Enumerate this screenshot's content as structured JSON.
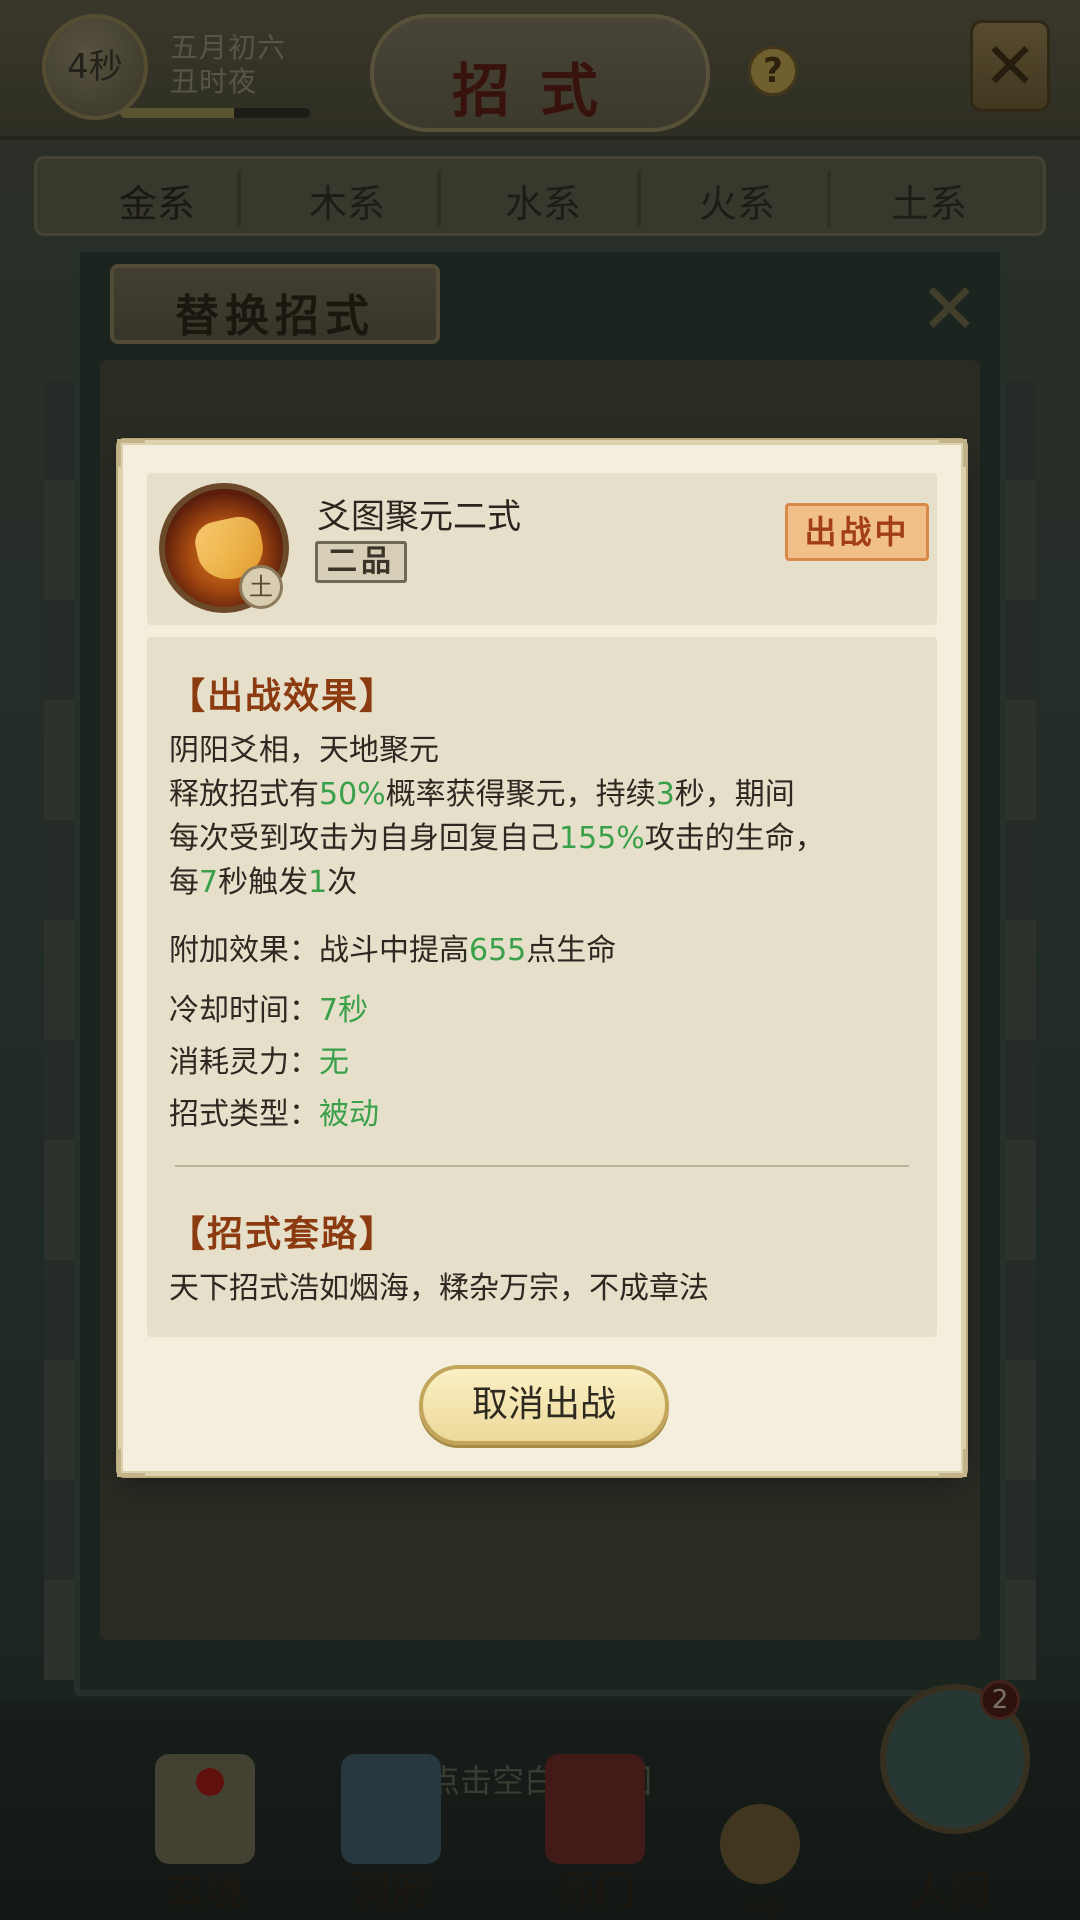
{
  "header": {
    "timer": "4秒",
    "date_line1": "五月初六",
    "date_line2": "丑时夜",
    "title": "招式",
    "help_symbol": "?",
    "time_progress": 0.6
  },
  "element_tabs": [
    "金系",
    "木系",
    "水系",
    "火系",
    "土系"
  ],
  "replace_panel": {
    "title": "替换招式"
  },
  "popup": {
    "skill_name": "爻图聚元二式",
    "grade": "二品",
    "element": "土",
    "status": "出战中",
    "effect_title": "【出战效果】",
    "effect_name": "阴阳爻相，天地聚元",
    "effect_line2_a": "释放招式有",
    "effect_line2_b": "50%",
    "effect_line2_c": "概率获得聚元，持续",
    "effect_line2_d": "3",
    "effect_line2_e": "秒，期间",
    "effect_line3_a": "每次受到攻击为自身回复自己",
    "effect_line3_b": "155%",
    "effect_line3_c": "攻击的生命，",
    "effect_line4_a": "每",
    "effect_line4_b": "7",
    "effect_line4_c": "秒触发",
    "effect_line4_d": "1",
    "effect_line4_e": "次",
    "bonus_label": "附加效果：",
    "bonus_a": "战斗中提高",
    "bonus_b": "655",
    "bonus_c": "点生命",
    "cooldown_label": "冷却时间：",
    "cooldown_value": "7秒",
    "cost_label": "消耗灵力：",
    "cost_value": "无",
    "type_label": "招式类型：",
    "type_value": "被动",
    "combo_title": "【招式套路】",
    "combo_text": "天下招式浩如烟海，糅杂万宗，不成章法",
    "cancel_label": "取消出战"
  },
  "bottom": {
    "return_hint": "点击空白处返回",
    "nav": [
      "玄境",
      "洞府",
      "师门",
      "人间"
    ],
    "bag_label": "行囊",
    "badge_count": "2"
  },
  "colors": {
    "highlight_green": "#3aa04a",
    "section_title": "#8c3a10",
    "status_badge": "#f1c08a"
  }
}
